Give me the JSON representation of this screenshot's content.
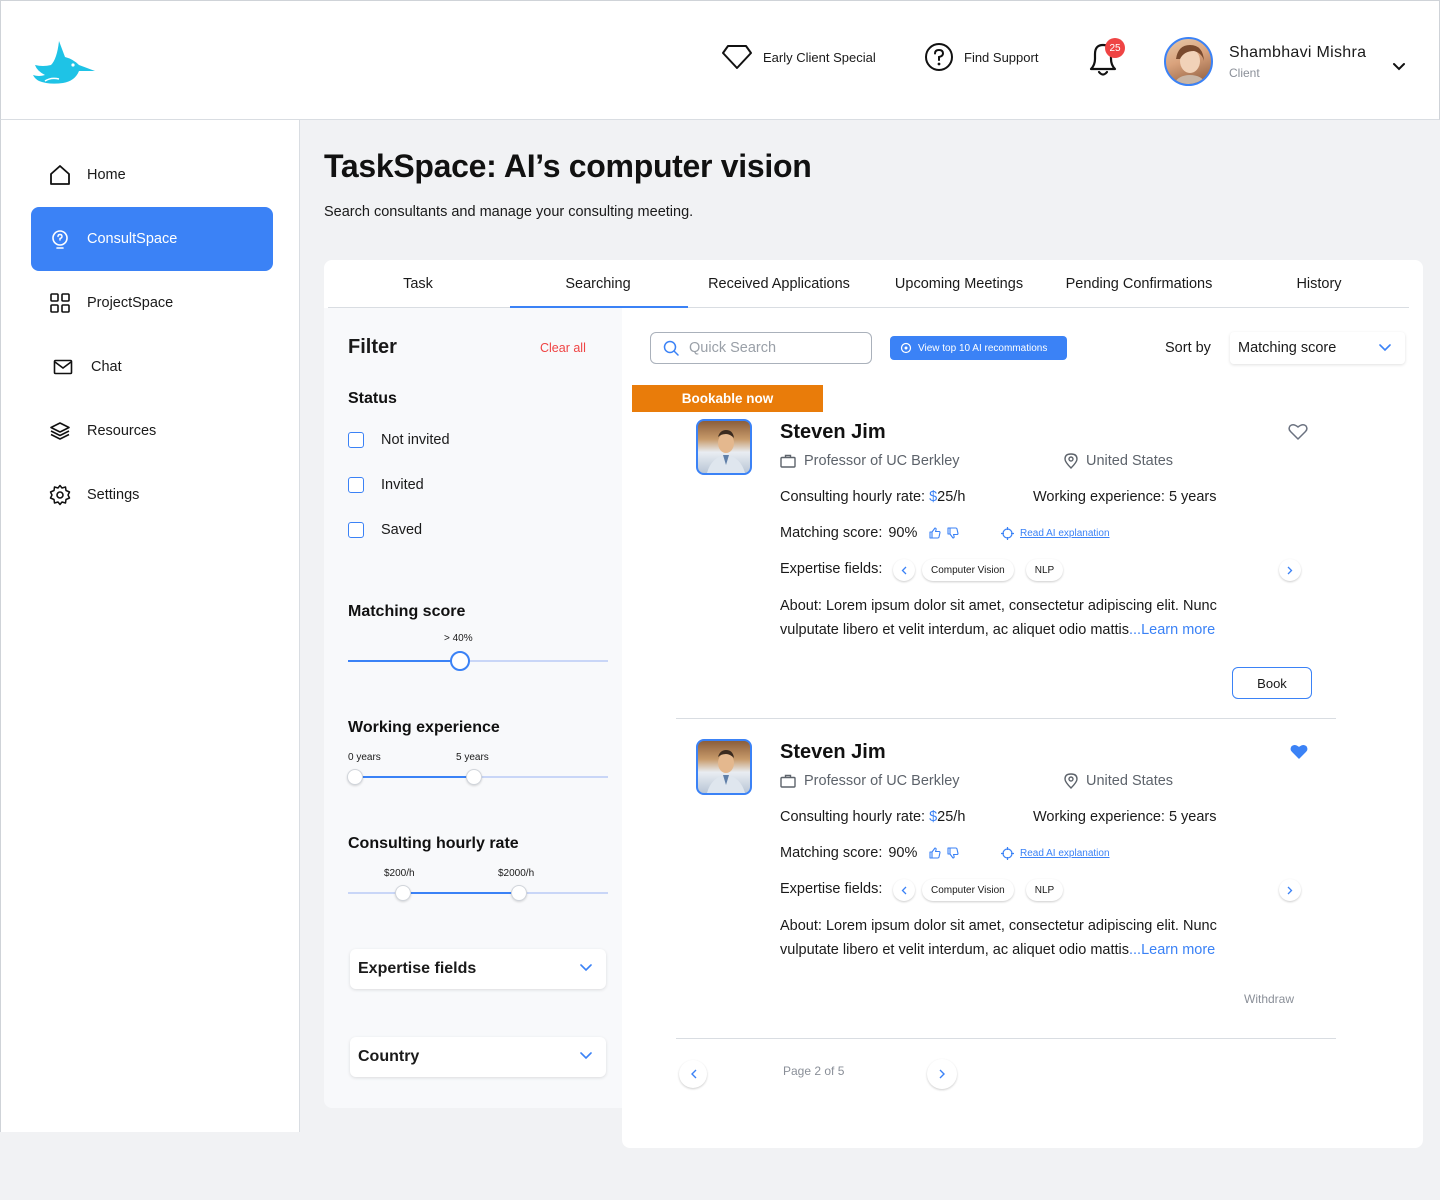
{
  "header": {
    "promo_label": "Early Client Special",
    "support_label": "Find Support",
    "notification_count": "25",
    "user_name": "Shambhavi Mishra",
    "user_role": "Client"
  },
  "sidebar": {
    "items": [
      {
        "label": "Home",
        "icon": "home-icon"
      },
      {
        "label": "ConsultSpace",
        "icon": "lightbulb-icon",
        "active": true
      },
      {
        "label": "ProjectSpace",
        "icon": "grid-icon"
      },
      {
        "label": "Chat",
        "icon": "mail-icon"
      },
      {
        "label": "Resources",
        "icon": "layers-icon"
      },
      {
        "label": "Settings",
        "icon": "gear-icon"
      }
    ]
  },
  "page": {
    "title": "TaskSpace: AI’s computer vision",
    "subtitle": "Search consultants and manage your consulting meeting."
  },
  "tabs": [
    {
      "label": "Task"
    },
    {
      "label": "Searching",
      "active": true
    },
    {
      "label": "Received Applications"
    },
    {
      "label": "Upcoming Meetings"
    },
    {
      "label": "Pending Confirmations"
    },
    {
      "label": "History"
    }
  ],
  "filter": {
    "title": "Filter",
    "clear_label": "Clear all",
    "status_title": "Status",
    "status_options": [
      "Not invited",
      "Invited",
      "Saved"
    ],
    "matching_title": "Matching score",
    "matching_value": "> 40%",
    "matching_level": 0.43,
    "experience_title": "Working experience",
    "experience_min": "0 years",
    "experience_max": "5 years",
    "rate_title": "Consulting hourly rate",
    "rate_min": "$200/h",
    "rate_max": "$2000/h",
    "expertise_dropdown": "Expertise fields",
    "country_dropdown": "Country"
  },
  "toolbar": {
    "search_placeholder": "Quick Search",
    "ai_button": "View top 10 AI recommations",
    "sort_label": "Sort by",
    "sort_value": "Matching score"
  },
  "bookable_badge": "Bookable now",
  "consultants": [
    {
      "name": "Steven Jim",
      "title": "Professor of UC Berkley",
      "location": "United States",
      "rate_label": "Consulting hourly rate:",
      "rate_currency": "$",
      "rate_value": "25/h",
      "experience": "Working experience: 5 years",
      "matching_label": "Matching score:",
      "matching_value": "90%",
      "ai_link": "Read AI explanation",
      "expertise_label": "Expertise fields:",
      "expertise": [
        "Computer Vision",
        "NLP"
      ],
      "about": "About: Lorem ipsum dolor sit amet, consectetur adipiscing elit. Nunc vulputate libero et velit interdum, ac aliquet odio mattis",
      "learn_more": "...Learn more",
      "action": "Book",
      "favorite": false
    },
    {
      "name": "Steven Jim",
      "title": "Professor of UC Berkley",
      "location": "United States",
      "rate_label": "Consulting hourly rate:",
      "rate_currency": "$",
      "rate_value": "25/h",
      "experience": "Working experience: 5 years",
      "matching_label": "Matching score:",
      "matching_value": "90%",
      "ai_link": "Read AI explanation",
      "expertise_label": "Expertise fields:",
      "expertise": [
        "Computer Vision",
        "NLP"
      ],
      "about": "About: Lorem ipsum dolor sit amet, consectetur adipiscing elit. Nunc vulputate libero et velit interdum, ac aliquet odio mattis",
      "learn_more": "...Learn more",
      "action": "Withdraw",
      "favorite": true
    }
  ],
  "pagination": {
    "label": "Page 2 of 5"
  },
  "colors": {
    "accent": "#3b82f6",
    "badge": "#e97c0a",
    "danger": "#ef4444",
    "logo": "#1ec3e6"
  }
}
